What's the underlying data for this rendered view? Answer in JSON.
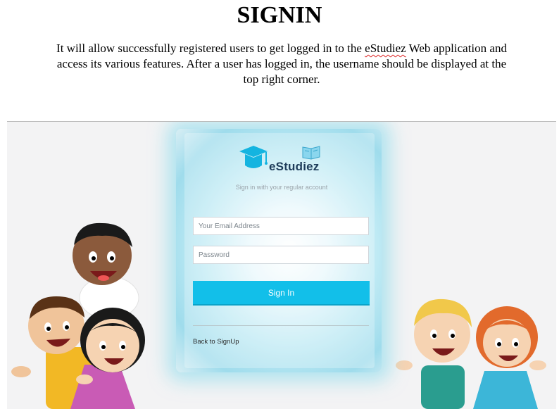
{
  "document": {
    "title": "SIGNIN",
    "description_parts": [
      "It will allow successfully registered users to get logged in to the ",
      "eStudiez",
      " Web application and access its various features. After a user has logged in, the username should be displayed at the top right corner."
    ]
  },
  "login": {
    "brand": "eStudiez",
    "subtitle": "Sign in with your regular account",
    "email_placeholder": "Your Email Address",
    "password_placeholder": "Password",
    "signin_label": "Sign In",
    "back_link": "Back to SignUp"
  },
  "colors": {
    "accent": "#12bfe9",
    "brand_text": "#1e3c5a"
  },
  "icons": [
    "graduation-cap-icon",
    "book-icon"
  ]
}
